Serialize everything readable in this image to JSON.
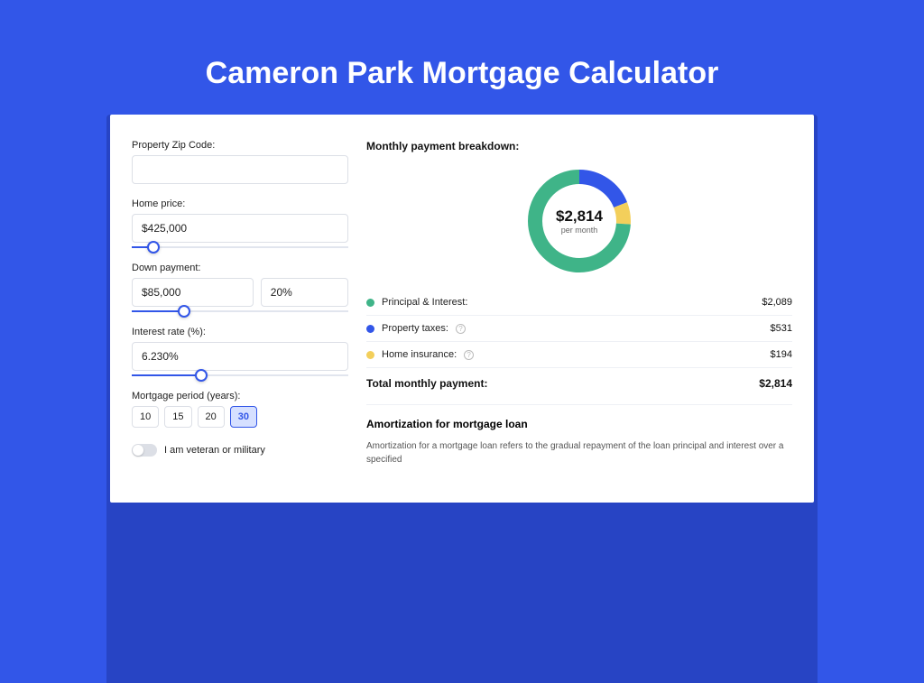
{
  "title": "Cameron Park Mortgage Calculator",
  "form": {
    "zip_label": "Property Zip Code:",
    "zip_value": "",
    "home_price_label": "Home price:",
    "home_price_value": "$425,000",
    "home_price_slider_pct": 10,
    "down_payment_label": "Down payment:",
    "down_payment_value": "$85,000",
    "down_payment_pct": "20%",
    "down_payment_slider_pct": 24,
    "interest_label": "Interest rate (%):",
    "interest_value": "6.230%",
    "interest_slider_pct": 32,
    "period_label": "Mortgage period (years):",
    "period_options": [
      "10",
      "15",
      "20",
      "30"
    ],
    "period_selected": "30",
    "vet_label": "I am veteran or military",
    "vet_on": false
  },
  "breakdown": {
    "heading": "Monthly payment breakdown:",
    "total_amount": "$2,814",
    "per_month": "per month",
    "items": [
      {
        "label": "Principal & Interest:",
        "value": "$2,089",
        "color": "#3fb488",
        "pct": 74,
        "has_info": false
      },
      {
        "label": "Property taxes:",
        "value": "$531",
        "color": "#3256e8",
        "pct": 19,
        "has_info": true
      },
      {
        "label": "Home insurance:",
        "value": "$194",
        "color": "#f3cf5b",
        "pct": 7,
        "has_info": true
      }
    ],
    "total_label": "Total monthly payment:",
    "total_value": "$2,814"
  },
  "amortization": {
    "heading": "Amortization for mortgage loan",
    "text": "Amortization for a mortgage loan refers to the gradual repayment of the loan principal and interest over a specified"
  },
  "chart_data": {
    "type": "pie",
    "title": "Monthly payment breakdown",
    "series": [
      {
        "name": "Principal & Interest",
        "value": 2089,
        "color": "#3fb488"
      },
      {
        "name": "Property taxes",
        "value": 531,
        "color": "#3256e8"
      },
      {
        "name": "Home insurance",
        "value": 194,
        "color": "#f3cf5b"
      }
    ],
    "total": 2814,
    "center_label": "$2,814 per month"
  }
}
